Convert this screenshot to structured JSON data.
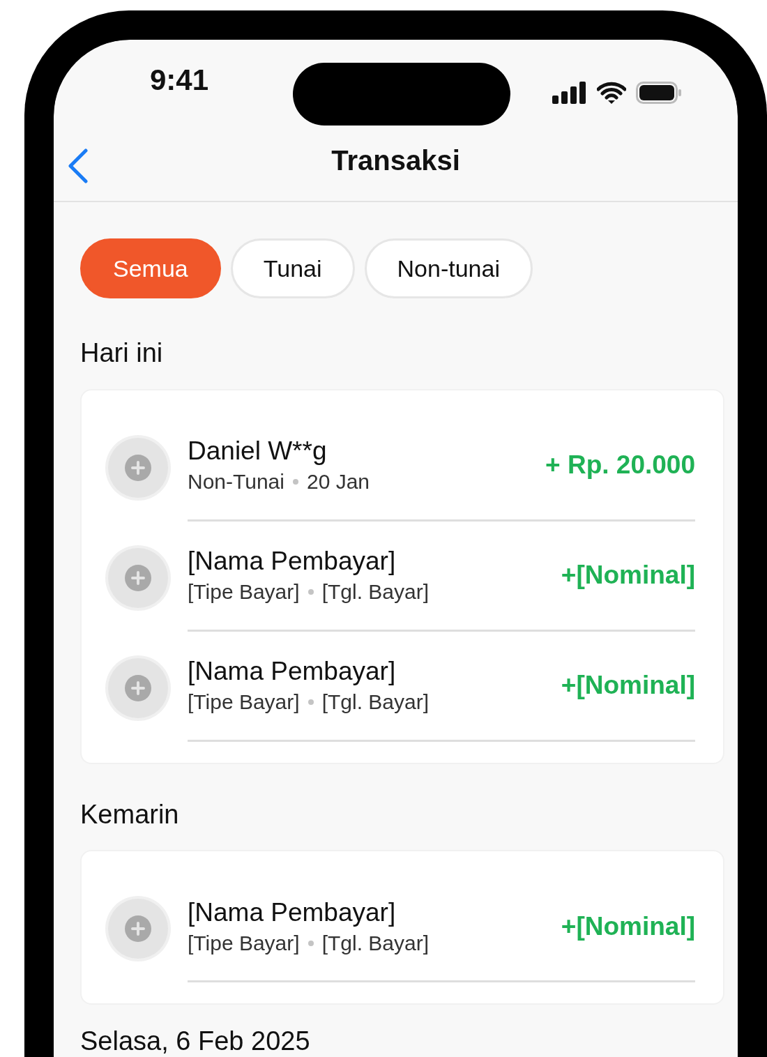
{
  "status_bar": {
    "time": "9:41"
  },
  "nav": {
    "title": "Transaksi"
  },
  "filters": [
    {
      "label": "Semua",
      "selected": true
    },
    {
      "label": "Tunai",
      "selected": false
    },
    {
      "label": "Non-tunai",
      "selected": false
    }
  ],
  "sections": [
    {
      "title": "Hari ini",
      "transactions": [
        {
          "name": "Daniel W**g",
          "payment_type": "Non-Tunai",
          "date": "20 Jan",
          "amount": "+ Rp. 20.000"
        },
        {
          "name": "[Nama Pembayar]",
          "payment_type": "[Tipe Bayar]",
          "date": "[Tgl. Bayar]",
          "amount": "+[Nominal]"
        },
        {
          "name": "[Nama Pembayar]",
          "payment_type": "[Tipe Bayar]",
          "date": "[Tgl. Bayar]",
          "amount": "+[Nominal]"
        }
      ]
    },
    {
      "title": "Kemarin",
      "transactions": [
        {
          "name": "[Nama Pembayar]",
          "payment_type": "[Tipe Bayar]",
          "date": "[Tgl. Bayar]",
          "amount": "+[Nominal]"
        }
      ]
    },
    {
      "title": "Selasa, 6 Feb 2025"
    }
  ]
}
